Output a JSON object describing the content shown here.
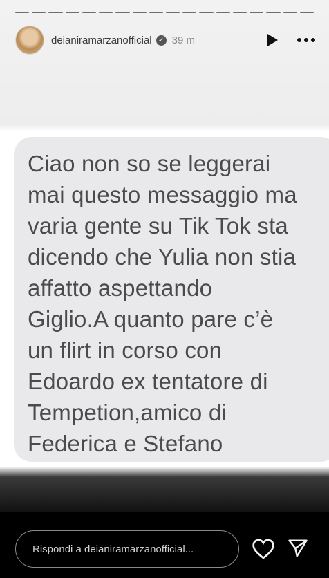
{
  "story": {
    "username": "deianiramarzanofficial",
    "time": "39 m",
    "progress_segments": 18
  },
  "message": {
    "text": "Ciao non so se leggerai\nmai questo messaggio ma\nvaria gente su Tik Tok sta\ndicendo che Yulia non stia\naffatto aspettando\nGiglio.A quanto pare c’è\nun flirt in corso con\nEdoardo ex tentatore di\nTempetion,amico di\nFederica e Stefano"
  },
  "footer": {
    "reply_placeholder": "Rispondi a deianiramarzanofficial..."
  },
  "icons": {
    "verified": "verified-badge-icon",
    "play": "play-icon",
    "more": "more-options-icon",
    "like": "heart-icon",
    "share": "send-icon"
  }
}
